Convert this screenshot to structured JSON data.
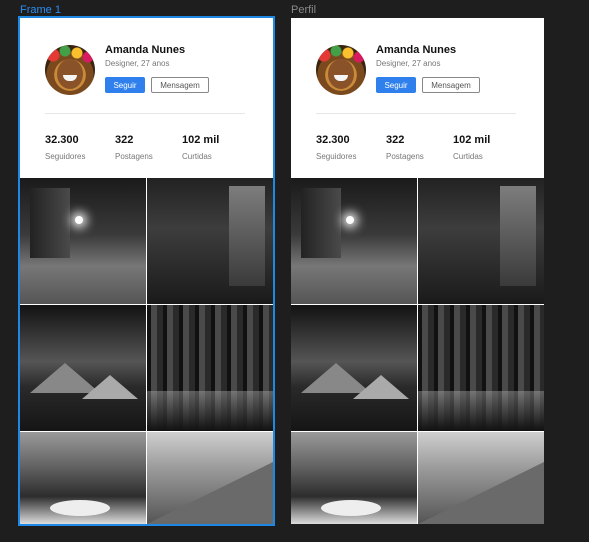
{
  "frames": [
    {
      "label": "Frame 1",
      "selected": true,
      "profile": {
        "name": "Amanda Nunes",
        "subtitle": "Designer, 27 anos",
        "follow_label": "Seguir",
        "message_label": "Mensagem",
        "stats": [
          {
            "value": "32.300",
            "label": "Seguidores"
          },
          {
            "value": "322",
            "label": "Postagens"
          },
          {
            "value": "102 mil",
            "label": "Curtidas"
          }
        ]
      }
    },
    {
      "label": "Perfil",
      "selected": false,
      "profile": {
        "name": "Amanda Nunes",
        "subtitle": "Designer, 27 anos",
        "follow_label": "Seguir",
        "message_label": "Mensagem",
        "stats": [
          {
            "value": "32.300",
            "label": "Seguidores"
          },
          {
            "value": "322",
            "label": "Postagens"
          },
          {
            "value": "102 mil",
            "label": "Curtidas"
          }
        ]
      }
    }
  ],
  "colors": {
    "canvas": "#1e1e1e",
    "selection": "#1e88e5",
    "primary_button": "#2f80ed"
  }
}
